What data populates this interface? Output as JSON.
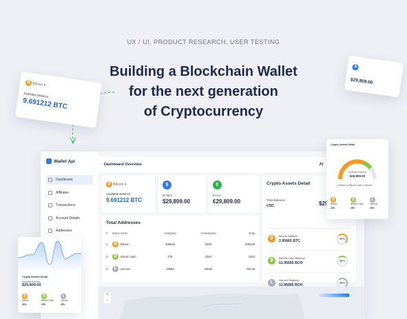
{
  "hero": {
    "eyebrow": "UX / UI, PRODUCT RESEARCH, USER TESTING",
    "title_line1": "Building a Blockchain Wallet",
    "title_line2": "for the next generation",
    "title_line3": "of Cryptocurrency"
  },
  "float_left": {
    "coin": "Bitcoin",
    "label": "Available Balance",
    "value": "9.691212 BTC"
  },
  "float_right": {
    "value": "$29,809.00"
  },
  "dashboard": {
    "logo": "Wallet Api",
    "title": "Dashboard Overview",
    "topbar_right": "JV",
    "nav": [
      "Dashboard",
      "Affiliates",
      "Transactions",
      "Account Details",
      "Addresses"
    ],
    "btc_card": {
      "coin": "Bitcoin",
      "label": "Available Balance",
      "value": "9.691212 BTC"
    },
    "usd_card": {
      "symbol": "$",
      "label": "Dollars",
      "value": "$29,809.00"
    },
    "eur_card": {
      "symbol": "€",
      "label": "Euros",
      "value": "€29,809.00"
    },
    "addresses": {
      "title": "Total Addresses",
      "columns": [
        "#",
        "Coins name",
        "Assigned",
        "Unassigned",
        "Total"
      ],
      "rows": [
        {
          "n": "1",
          "coin": "Bitcoin",
          "assigned": "306648",
          "unassigned": "2300",
          "total": "308148"
        },
        {
          "n": "2",
          "coin": "Bitcoin cash",
          "assigned": "379",
          "unassigned": "2304",
          "total": "2363"
        },
        {
          "n": "3",
          "coin": "Litecoin",
          "assigned": "48869",
          "unassigned": "29030",
          "total": "780.59"
        }
      ]
    },
    "assets": {
      "title": "Crypto Assets Detail",
      "total_label": "Total Balance",
      "currency": "USD",
      "total_value": "$29",
      "rows": [
        {
          "name": "Bitcoin Balance",
          "value": "2.95665 BTC",
          "pct": "40%",
          "color": "#f39a22"
        },
        {
          "name": "Bitcoin Cash Balance",
          "value": "12.95665 BCH",
          "pct": "25%",
          "color": "#8dc63f"
        },
        {
          "name": "Litecoin Balance",
          "value": "12.95665 BCH",
          "pct": "35%",
          "color": "#a7adb9"
        }
      ]
    }
  },
  "gauge_card": {
    "title": "Crypto Assets Detail",
    "center_label": "Available Balance",
    "center_value": "$29,809.00",
    "legend": "● Bitcoin  ● Bitcoin Cash  ● Litecoin",
    "items": [
      {
        "name": "Bitcoin",
        "pct": "40%"
      },
      {
        "name": "Bitcoin Cash",
        "pct": "25%"
      },
      {
        "name": "Litecoin",
        "pct": "35%"
      }
    ]
  },
  "wave_card": {
    "title": "Crypto Assets Detail",
    "label": "Available Balance",
    "value": "$29,809.00",
    "items": [
      {
        "name": "Bitcoin",
        "pct": "40%"
      },
      {
        "name": "Bitcoin Cash",
        "pct": "25%"
      },
      {
        "name": "Litecoin",
        "pct": "35%"
      }
    ]
  }
}
